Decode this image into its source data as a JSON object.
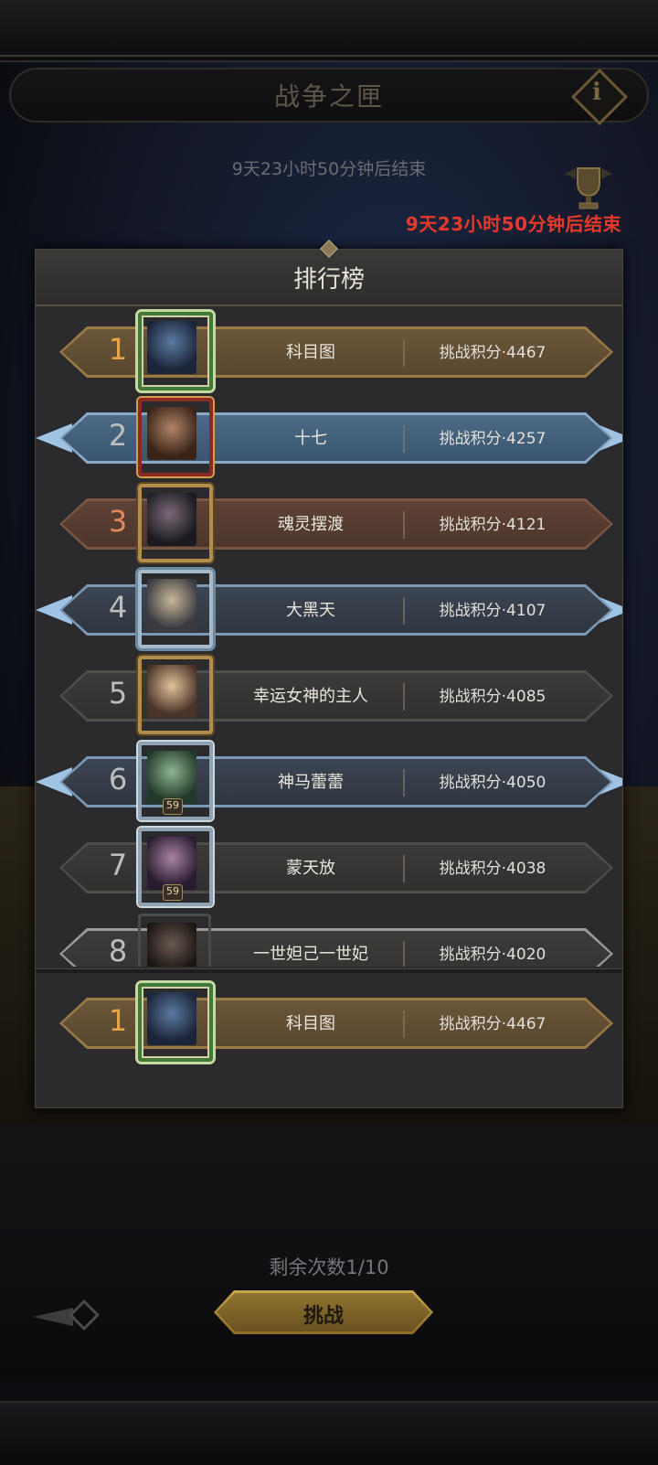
{
  "header": {
    "title": "战争之匣",
    "info_label": "i",
    "countdown": "9天23小时50分钟后结束"
  },
  "trophy": {
    "countdown": "9天23小时50分钟后结束"
  },
  "leaderboard": {
    "title": "排行榜",
    "rows": [
      {
        "rank": "1",
        "name": "科目图",
        "score": "挑战积分·4467"
      },
      {
        "rank": "2",
        "name": "十七",
        "score": "挑战积分·4257"
      },
      {
        "rank": "3",
        "name": "魂灵摆渡",
        "score": "挑战积分·4121"
      },
      {
        "rank": "4",
        "name": "大黑天",
        "score": "挑战积分·4107"
      },
      {
        "rank": "5",
        "name": "幸运女神的主人",
        "score": "挑战积分·4085"
      },
      {
        "rank": "6",
        "name": "神马蕾蕾",
        "score": "挑战积分·4050",
        "level": "59"
      },
      {
        "rank": "7",
        "name": "蒙天放",
        "score": "挑战积分·4038",
        "level": "59"
      },
      {
        "rank": "8",
        "name": "一世妲己一世妃",
        "score": "挑战积分·4020"
      }
    ],
    "self": {
      "rank": "1",
      "name": "科目图",
      "score": "挑战积分·4467"
    }
  },
  "footer": {
    "remaining": "剩余次数1/10",
    "challenge_label": "挑战"
  },
  "colors": {
    "gold_text": "#e8a446",
    "alert_red": "#e5392c",
    "panel_bg": "#2b2b2d"
  }
}
